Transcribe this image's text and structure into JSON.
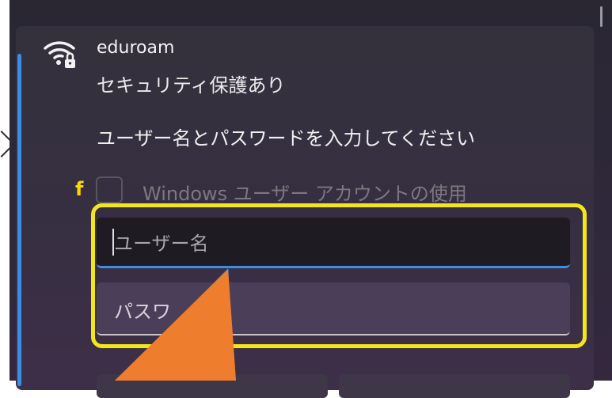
{
  "network": {
    "ssid": "eduroam",
    "security_status": "セキュリティ保護あり",
    "icon": "wifi-secured-icon"
  },
  "auth": {
    "prompt": "ユーザー名とパスワードを入力してください",
    "windows_account_checkbox": {
      "label": "Windows ユーザー アカウントの使用",
      "checked": false,
      "enabled": false
    },
    "username": {
      "placeholder": "ユーザー名",
      "value": ""
    },
    "password": {
      "placeholder": "パスワ",
      "value": ""
    }
  },
  "annotations": {
    "step_label": "f",
    "highlight_color": "#f5e61c",
    "arrow_color": "#ee7d2e"
  },
  "colors": {
    "accent": "#3a8ee6",
    "background": "#2d2838"
  }
}
